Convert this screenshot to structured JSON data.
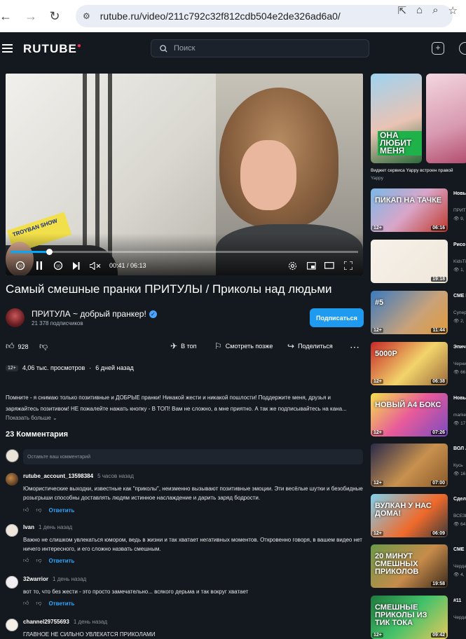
{
  "browser": {
    "url": "rutube.ru/video/211c792c32f812cdb504e2de326ad6a0/"
  },
  "header": {
    "logo": "RUTUBE",
    "search_placeholder": "Поиск"
  },
  "player": {
    "ticket_text": "TROYBAN SHOW",
    "time": "00:41 / 06:13",
    "progress_fraction": 0.11
  },
  "video": {
    "title": "Самый смешные пранки ПРИТУЛЫ / Приколы над людьми",
    "channel": "ПРИТУЛА ~ добрый пранкер!",
    "subscribers": "21 378 подписчиков",
    "subscribe_label": "Подписаться",
    "likes": "928",
    "actions": {
      "top": "В топ",
      "watch_later": "Смотреть позже",
      "share": "Поделиться"
    },
    "age": "12+",
    "views": "4,06 тыс. просмотров",
    "posted": "6 дней назад",
    "description": "Помните - я снимаю только позитивные и ДОБРЫЕ пранки! Никакой жести и никакой пошлости! Поддержите меня, друзья и заряжайтесь позитивом! НЕ пожалейте нажать кнопку - В ТОП! Вам не сложно, а мне приятно. А так же подписывайтесь на кана...",
    "show_more": "Показать больше"
  },
  "comments": {
    "heading": "23 Комментария",
    "input_placeholder": "Оставьте ваш комментарий",
    "reply_label": "Ответить",
    "items": [
      {
        "author": "rutube_account_13598384",
        "time": "5 часов назад",
        "text": "Юмористические выходки, известные как \"приколы\", неизменно вызывают позитивные эмоции. Эти весёлые шутки и безобидные розыгрыши способны доставлять людям истинное наслаждение и дарить заряд бодрости."
      },
      {
        "author": "Ivan",
        "time": "1 день назад",
        "text": "Важно не слишком увлекаться юмором, ведь в жизни и так хватает негативных моментов. Откровенно говоря, в вашем видео нет ничего интересного, и его сложно назвать смешным."
      },
      {
        "author": "32warrior",
        "time": "1 день назад",
        "text": "вот то, что без жести - это просто замечательно... всякого дерьма и так вокруг хватает"
      },
      {
        "author": "channel29755693",
        "time": "1 день назад",
        "text": "ГЛАВНОЕ НЕ СИЛЬНО УВЛЕКАТСЯ ПРИКОЛАМИ"
      }
    ]
  },
  "sidebar": {
    "featured_caption": "Виджет сервиса Yappy встроен правой",
    "featured_source": "Yappy",
    "featured_text": "ОНА ЛЮБИТ МЕНЯ",
    "items": [
      {
        "badge": "12+",
        "duration": "06:16",
        "title": "Новые прик",
        "sub": "ПРИТ",
        "views": "9,",
        "thumb_text": "ПИКАП НА ТАЧКЕ"
      },
      {
        "badge": "",
        "duration": "19:18",
        "title": "Рисо раск",
        "sub": "KidsTi",
        "views": "1,",
        "thumb_text": ""
      },
      {
        "badge": "12+",
        "duration": "11:44",
        "title": "СМЕ ПРИ",
        "sub": "Супер",
        "views": "2,",
        "thumb_text": "#5"
      },
      {
        "badge": "12+",
        "duration": "06:38",
        "title": "Эпич стр",
        "sub": "Черни",
        "views": "66",
        "thumb_text": "5000Р"
      },
      {
        "badge": "12+",
        "duration": "07:26",
        "title": "Новы",
        "sub": "marke",
        "views": "17",
        "thumb_text": "НОВЫЙ А4 БОКС"
      },
      {
        "badge": "12+",
        "duration": "07:00",
        "title": "ВОЛ АУС",
        "sub": "Кусь",
        "views": "16",
        "thumb_text": ""
      },
      {
        "badge": "12+",
        "duration": "06:09",
        "title": "Сдел вулк",
        "sub": "ВСЕЗН",
        "views": "64",
        "thumb_text": "ВУЛКАН У НАС ДОМА!"
      },
      {
        "badge": "",
        "duration": "19:58",
        "title": "СМЕ",
        "sub": "Черда",
        "views": "4,",
        "thumb_text": "20 МИНУТ СМЕШНЫХ ПРИКОЛОВ"
      },
      {
        "badge": "12+",
        "duration": "09:42",
        "title": "#11",
        "sub": "Черда",
        "views": "",
        "thumb_text": "СМЕШНЫЕ ПРИКОЛЫ ИЗ ТИК ТОКА"
      }
    ]
  },
  "colors": {
    "background": "#14191f",
    "accent": "#1e9bf0",
    "reply": "#2ea6ff",
    "progress": "#00a8ff"
  }
}
